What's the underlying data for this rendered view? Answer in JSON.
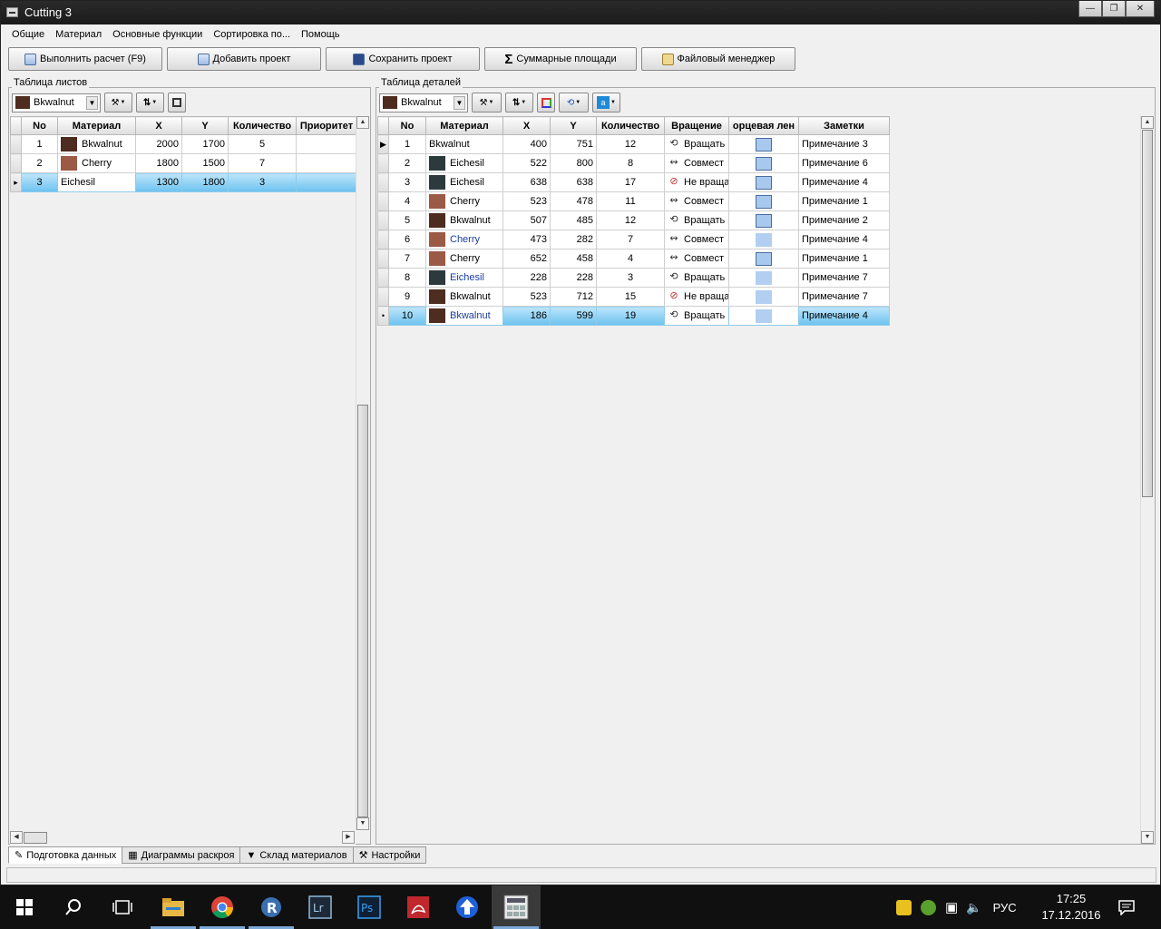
{
  "window": {
    "title": "Cutting 3"
  },
  "menu": [
    "Общие",
    "Материал",
    "Основные функции",
    "Сортировка по...",
    "Помощь"
  ],
  "toolbar": {
    "run": "Выполнить расчет (F9)",
    "add_project": "Добавить проект",
    "save_project": "Сохранить проект",
    "total_areas": "Суммарные площади",
    "file_manager": "Файловый менеджер"
  },
  "sheets": {
    "group_title": "Таблица листов",
    "combo_value": "Bkwalnut",
    "columns": [
      "No",
      "Материал",
      "X",
      "Y",
      "Количество",
      "Приоритет"
    ],
    "rows": [
      {
        "no": "1",
        "material": "Bkwalnut",
        "swatch": "#4e2c20",
        "x": "2000",
        "y": "1700",
        "qty": "5",
        "priority": ""
      },
      {
        "no": "2",
        "material": "Cherry",
        "swatch": "#9a5a45",
        "x": "1800",
        "y": "1500",
        "qty": "7",
        "priority": ""
      },
      {
        "no": "3",
        "material": "Eichesil",
        "swatch": "",
        "x": "1300",
        "y": "1800",
        "qty": "3",
        "priority": ""
      }
    ]
  },
  "parts": {
    "group_title": "Таблица деталей",
    "combo_value": "Bkwalnut",
    "columns": [
      "No",
      "Материал",
      "X",
      "Y",
      "Количество",
      "Вращение",
      "орцевая лен",
      "Заметки"
    ],
    "rows": [
      {
        "no": "1",
        "material": "Bkwalnut",
        "swatch": "",
        "link": false,
        "x": "400",
        "y": "751",
        "qty": "12",
        "rotation": "Вращать",
        "rot_icon": "rotate-icon",
        "edge_border": true,
        "note": "Примечание 3"
      },
      {
        "no": "2",
        "material": "Eichesil",
        "swatch": "#2c3a3e",
        "link": false,
        "x": "522",
        "y": "800",
        "qty": "8",
        "rotation": "Совмест",
        "rot_icon": "combine-icon",
        "edge_border": true,
        "note": "Примечание 6"
      },
      {
        "no": "3",
        "material": "Eichesil",
        "swatch": "#2c3a3e",
        "link": false,
        "x": "638",
        "y": "638",
        "qty": "17",
        "rotation": "Не враща",
        "rot_icon": "no-rotate-icon",
        "edge_border": true,
        "note": "Примечание 4"
      },
      {
        "no": "4",
        "material": "Cherry",
        "swatch": "#9a5a45",
        "link": false,
        "x": "523",
        "y": "478",
        "qty": "11",
        "rotation": "Совмест",
        "rot_icon": "combine-icon",
        "edge_border": true,
        "note": "Примечание 1"
      },
      {
        "no": "5",
        "material": "Bkwalnut",
        "swatch": "#4e2c20",
        "link": false,
        "x": "507",
        "y": "485",
        "qty": "12",
        "rotation": "Вращать",
        "rot_icon": "rotate-icon",
        "edge_border": true,
        "note": "Примечание 2"
      },
      {
        "no": "6",
        "material": "Cherry",
        "swatch": "#9a5a45",
        "link": true,
        "x": "473",
        "y": "282",
        "qty": "7",
        "rotation": "Совмест",
        "rot_icon": "combine-icon",
        "edge_border": false,
        "note": "Примечание 4"
      },
      {
        "no": "7",
        "material": "Cherry",
        "swatch": "#9a5a45",
        "link": false,
        "x": "652",
        "y": "458",
        "qty": "4",
        "rotation": "Совмест",
        "rot_icon": "combine-icon",
        "edge_border": true,
        "note": "Примечание 1"
      },
      {
        "no": "8",
        "material": "Eichesil",
        "swatch": "#2c3a3e",
        "link": true,
        "x": "228",
        "y": "228",
        "qty": "3",
        "rotation": "Вращать",
        "rot_icon": "rotate-icon",
        "edge_border": false,
        "note": "Примечание 7"
      },
      {
        "no": "9",
        "material": "Bkwalnut",
        "swatch": "#4e2c20",
        "link": false,
        "x": "523",
        "y": "712",
        "qty": "15",
        "rotation": "Не враща",
        "rot_icon": "no-rotate-icon",
        "edge_border": false,
        "note": "Примечание 7"
      },
      {
        "no": "10",
        "material": "Bkwalnut",
        "swatch": "#4e2c20",
        "link": true,
        "x": "186",
        "y": "599",
        "qty": "19",
        "rotation": "Вращать",
        "rot_icon": "rotate-icon",
        "edge_border": false,
        "note": "Примечание 4"
      }
    ]
  },
  "tabs": [
    "Подготовка данных",
    "Диаграммы раскроя",
    "Склад материалов",
    "Настройки"
  ],
  "taskbar": {
    "lang": "РУС",
    "time": "17:25",
    "date": "17.12.2016",
    "apps": [
      "start-icon",
      "search-icon",
      "task-view-icon",
      "file-explorer-icon",
      "chrome-icon",
      "app-r-icon",
      "lightroom-icon",
      "photoshop-icon",
      "acrobat-icon",
      "upload-arrow-icon",
      "cutting-app-icon"
    ]
  },
  "colors": {
    "selection": "#6cc2ef",
    "link": "#1a3ea0",
    "edge": "#a9c8ee"
  }
}
